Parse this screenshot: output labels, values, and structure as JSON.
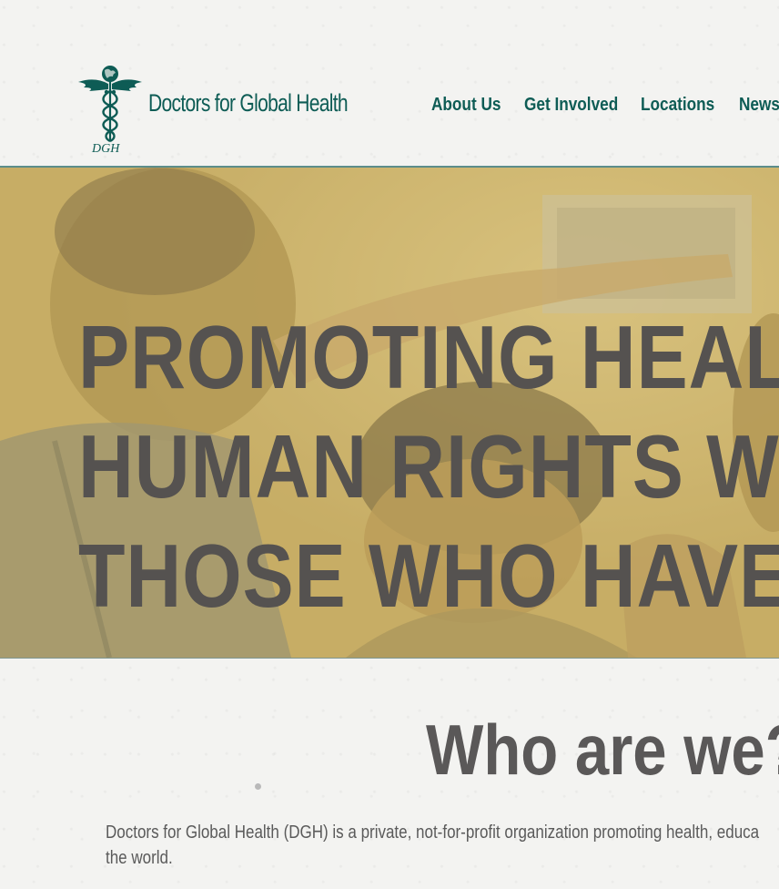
{
  "site": {
    "brand_name": "Doctors for Global Health",
    "logo_initials": "DGH"
  },
  "nav": {
    "items": [
      {
        "label": "About Us"
      },
      {
        "label": "Get Involved"
      },
      {
        "label": "Locations"
      },
      {
        "label": "News"
      }
    ]
  },
  "hero": {
    "headline_lines": [
      "PROMOTING HEALTH",
      "HUMAN RIGHTS WITH",
      "THOSE WHO HAVE N"
    ]
  },
  "who": {
    "title": "Who are we?",
    "description": "Doctors for Global Health (DGH) is a private, not-for-profit organization promoting health, educa the world."
  },
  "colors": {
    "brand_teal": "#0e5c55",
    "hero_tint": "#c9b26e",
    "headline_gray": "#555250",
    "background": "#f3f3f1"
  }
}
